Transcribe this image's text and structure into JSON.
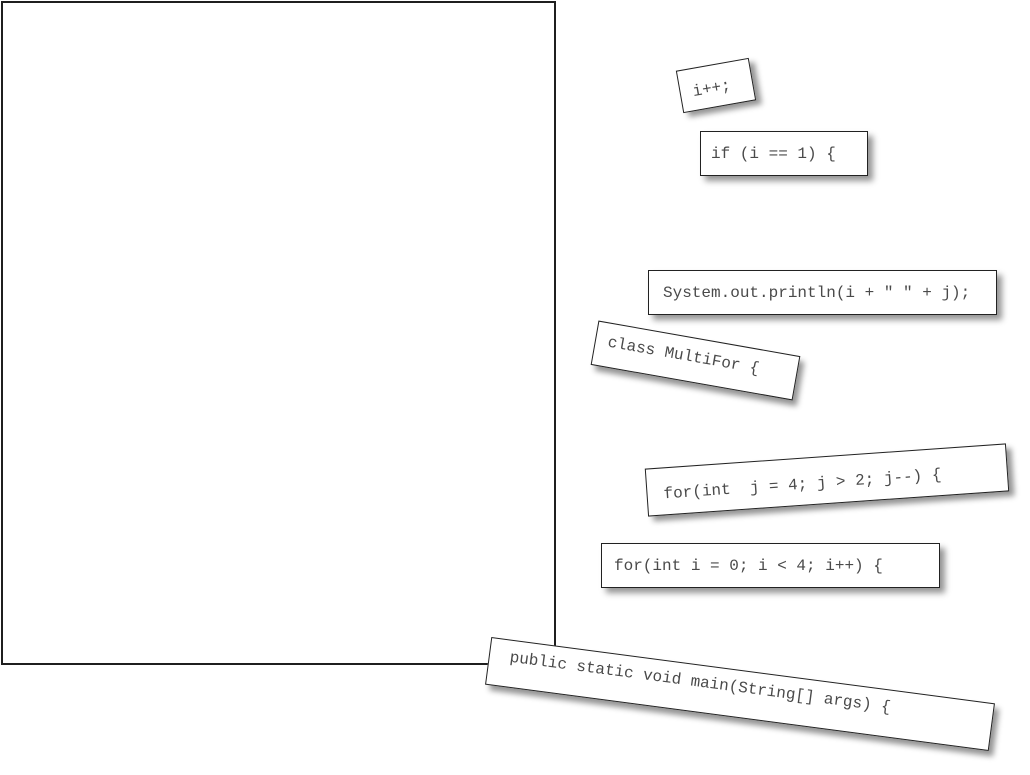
{
  "magnets": [
    {
      "id": "iplusplus",
      "text": "i++;"
    },
    {
      "id": "if",
      "text": "if (i == 1) {"
    },
    {
      "id": "println",
      "text": "System.out.println(i + \" \" + j);"
    },
    {
      "id": "class",
      "text": "class MultiFor {"
    },
    {
      "id": "forj",
      "text": "for(int  j = 4; j > 2; j--) {"
    },
    {
      "id": "fori",
      "text": "for(int i = 0; i < 4; i++) {"
    },
    {
      "id": "main",
      "text": "public static void main(String[] args) {"
    }
  ]
}
